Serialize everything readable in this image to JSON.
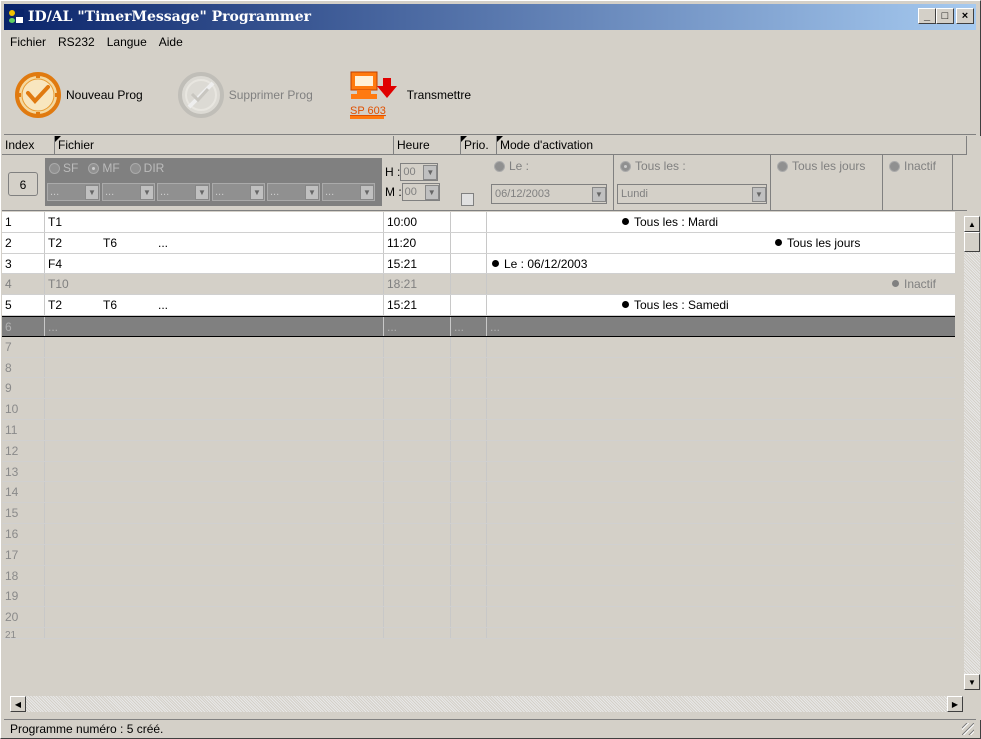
{
  "window": {
    "title": "ID/AL \"TimerMessage\" Programmer",
    "controls": [
      "_",
      "□",
      "×"
    ]
  },
  "menu": [
    "Fichier",
    "RS232",
    "Langue",
    "Aide"
  ],
  "toolbar": {
    "new_label": "Nouveau Prog",
    "delete_label": "Supprimer Prog",
    "transmit_device": "SP 603",
    "transmit_label": "Transmettre"
  },
  "columns": {
    "index": "Index",
    "fichier": "Fichier",
    "heure": "Heure",
    "prio": "Prio.",
    "mode": "Mode d'activation"
  },
  "filter": {
    "index_value": "6",
    "type_options": [
      "SF",
      "MF",
      "DIR"
    ],
    "file_placeholder": "...",
    "h_label": "H :",
    "m_label": "M :",
    "h_value": "00",
    "m_value": "00",
    "mode_le": "Le :",
    "mode_tous_les": "Tous les :",
    "mode_tous_jours": "Tous les jours",
    "mode_inactif": "Inactif",
    "date_value": "06/12/2003",
    "day_value": "Lundi"
  },
  "rows": [
    {
      "index": "1",
      "f1": "T1",
      "f2": "",
      "f3": "",
      "heure": "10:00",
      "mode": "Tous les : Mardi"
    },
    {
      "index": "2",
      "f1": "T2",
      "f2": "T6",
      "f3": "...",
      "heure": "11:20",
      "mode": "Tous les jours"
    },
    {
      "index": "3",
      "f1": "F4",
      "f2": "",
      "f3": "",
      "heure": "15:21",
      "mode": "Le : 06/12/2003"
    },
    {
      "index": "4",
      "f1": "T10",
      "f2": "",
      "f3": "",
      "heure": "18:21",
      "mode": "Inactif"
    },
    {
      "index": "5",
      "f1": "T2",
      "f2": "T6",
      "f3": "...",
      "heure": "15:21",
      "mode": "Tous les : Samedi"
    },
    {
      "index": "6",
      "f1": "...",
      "f2": "",
      "f3": "",
      "heure": "...",
      "prio": "...",
      "mode": "..."
    }
  ],
  "empty_rows": [
    "7",
    "8",
    "9",
    "10",
    "11",
    "12",
    "13",
    "14",
    "15",
    "16",
    "17",
    "18",
    "19",
    "20",
    "21"
  ],
  "status": "Programme numéro : 5 créé."
}
